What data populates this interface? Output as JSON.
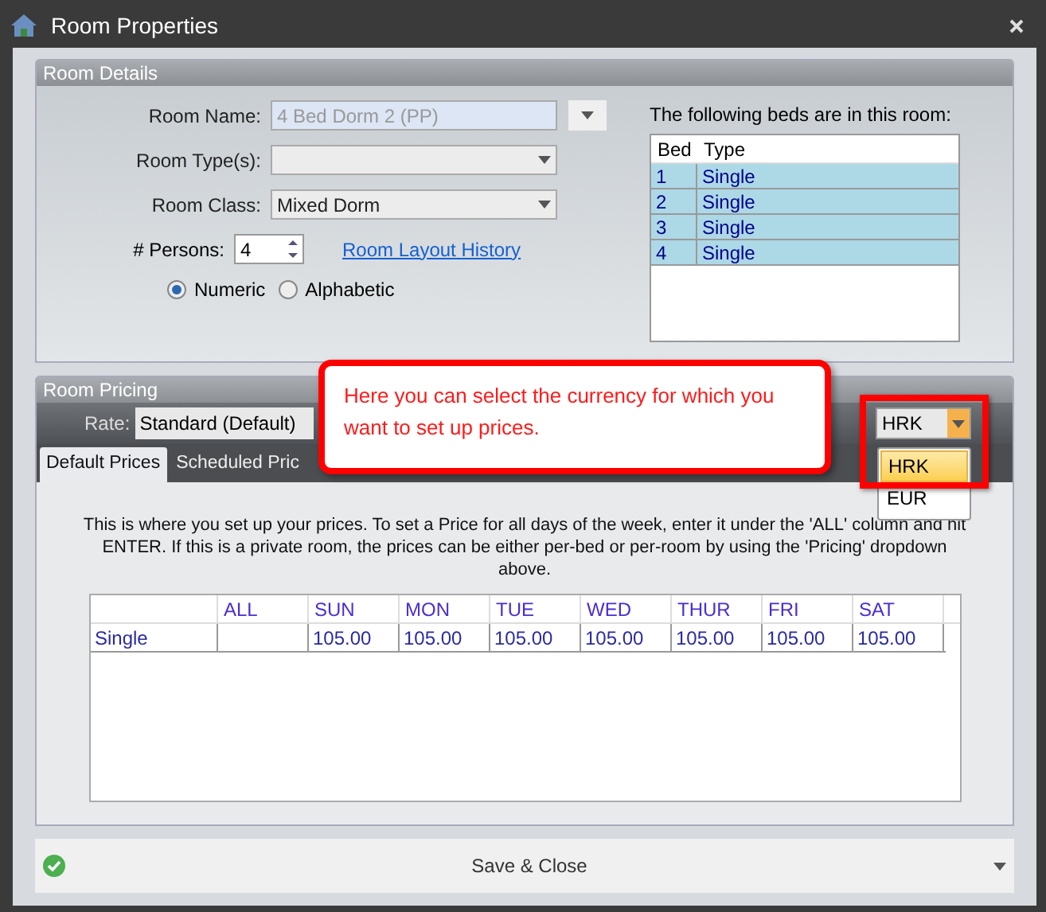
{
  "window": {
    "title": "Room Properties"
  },
  "room_details": {
    "title": "Room Details",
    "fields": [
      {
        "label": "Room Name:",
        "value": "4 Bed Dorm 2 (PP)",
        "disabled": true
      },
      {
        "label": "Room Type(s):",
        "disabled": false
      },
      {
        "label": "Room Class:",
        "value": "Mixed Dorm",
        "disabled": false
      }
    ],
    "persons": {
      "label": "# Persons:",
      "value": "4"
    },
    "link": "Room Layout History",
    "radios": [
      {
        "label": "Numeric",
        "selected": true
      },
      {
        "label": "Alphabetic",
        "selected": false
      }
    ],
    "beds": {
      "caption": "The following beds are in this room:",
      "columns": [
        "Bed",
        "Type"
      ],
      "rows": [
        [
          "1",
          "Single"
        ],
        [
          "2",
          "Single"
        ],
        [
          "3",
          "Single"
        ],
        [
          "4",
          "Single"
        ]
      ]
    }
  },
  "room_pricing": {
    "title": "Room Pricing",
    "rate_label": "Rate:",
    "rate_value": "Standard (Default)",
    "currency": {
      "value": "HRK",
      "options": [
        {
          "label": "HRK",
          "selected": true
        },
        {
          "label": "EUR",
          "selected": false
        }
      ]
    },
    "tabs": [
      {
        "label": "Default Prices",
        "selected": true
      },
      {
        "label": "Scheduled Pric",
        "selected": false
      }
    ],
    "description": "This is where you set up your prices.  To set a Price for all days of the week, enter it under the 'ALL' column and hit ENTER.  If this is a private room, the prices can be either per-bed or per-room by using the 'Pricing' dropdown above.",
    "table": {
      "columns": [
        "",
        "ALL",
        "SUN",
        "MON",
        "TUE",
        "WED",
        "THUR",
        "FRI",
        "SAT"
      ],
      "rows": [
        [
          "Single",
          "",
          "105.00",
          "105.00",
          "105.00",
          "105.00",
          "105.00",
          "105.00",
          "105.00"
        ]
      ]
    }
  },
  "callout": "Here you can select the currency for which you want to set up prices.",
  "save_button": "Save & Close"
}
